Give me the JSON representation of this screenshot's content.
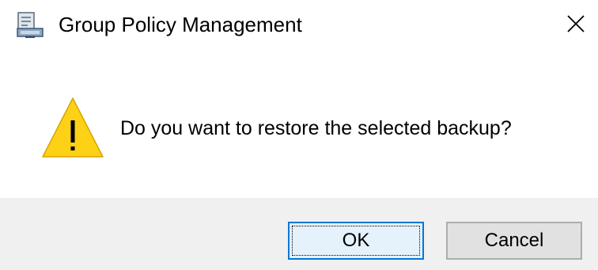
{
  "window": {
    "title": "Group Policy Management",
    "app_icon": "group-policy-icon",
    "close_icon": "close-icon"
  },
  "message": {
    "icon": "warning-icon",
    "text": "Do you want to restore the selected backup?"
  },
  "buttons": {
    "ok_label": "OK",
    "cancel_label": "Cancel",
    "default": "OK"
  },
  "colors": {
    "footer_background": "#f0f0f0",
    "default_button_border": "#0078d7",
    "warning_fill": "#fcd116"
  }
}
